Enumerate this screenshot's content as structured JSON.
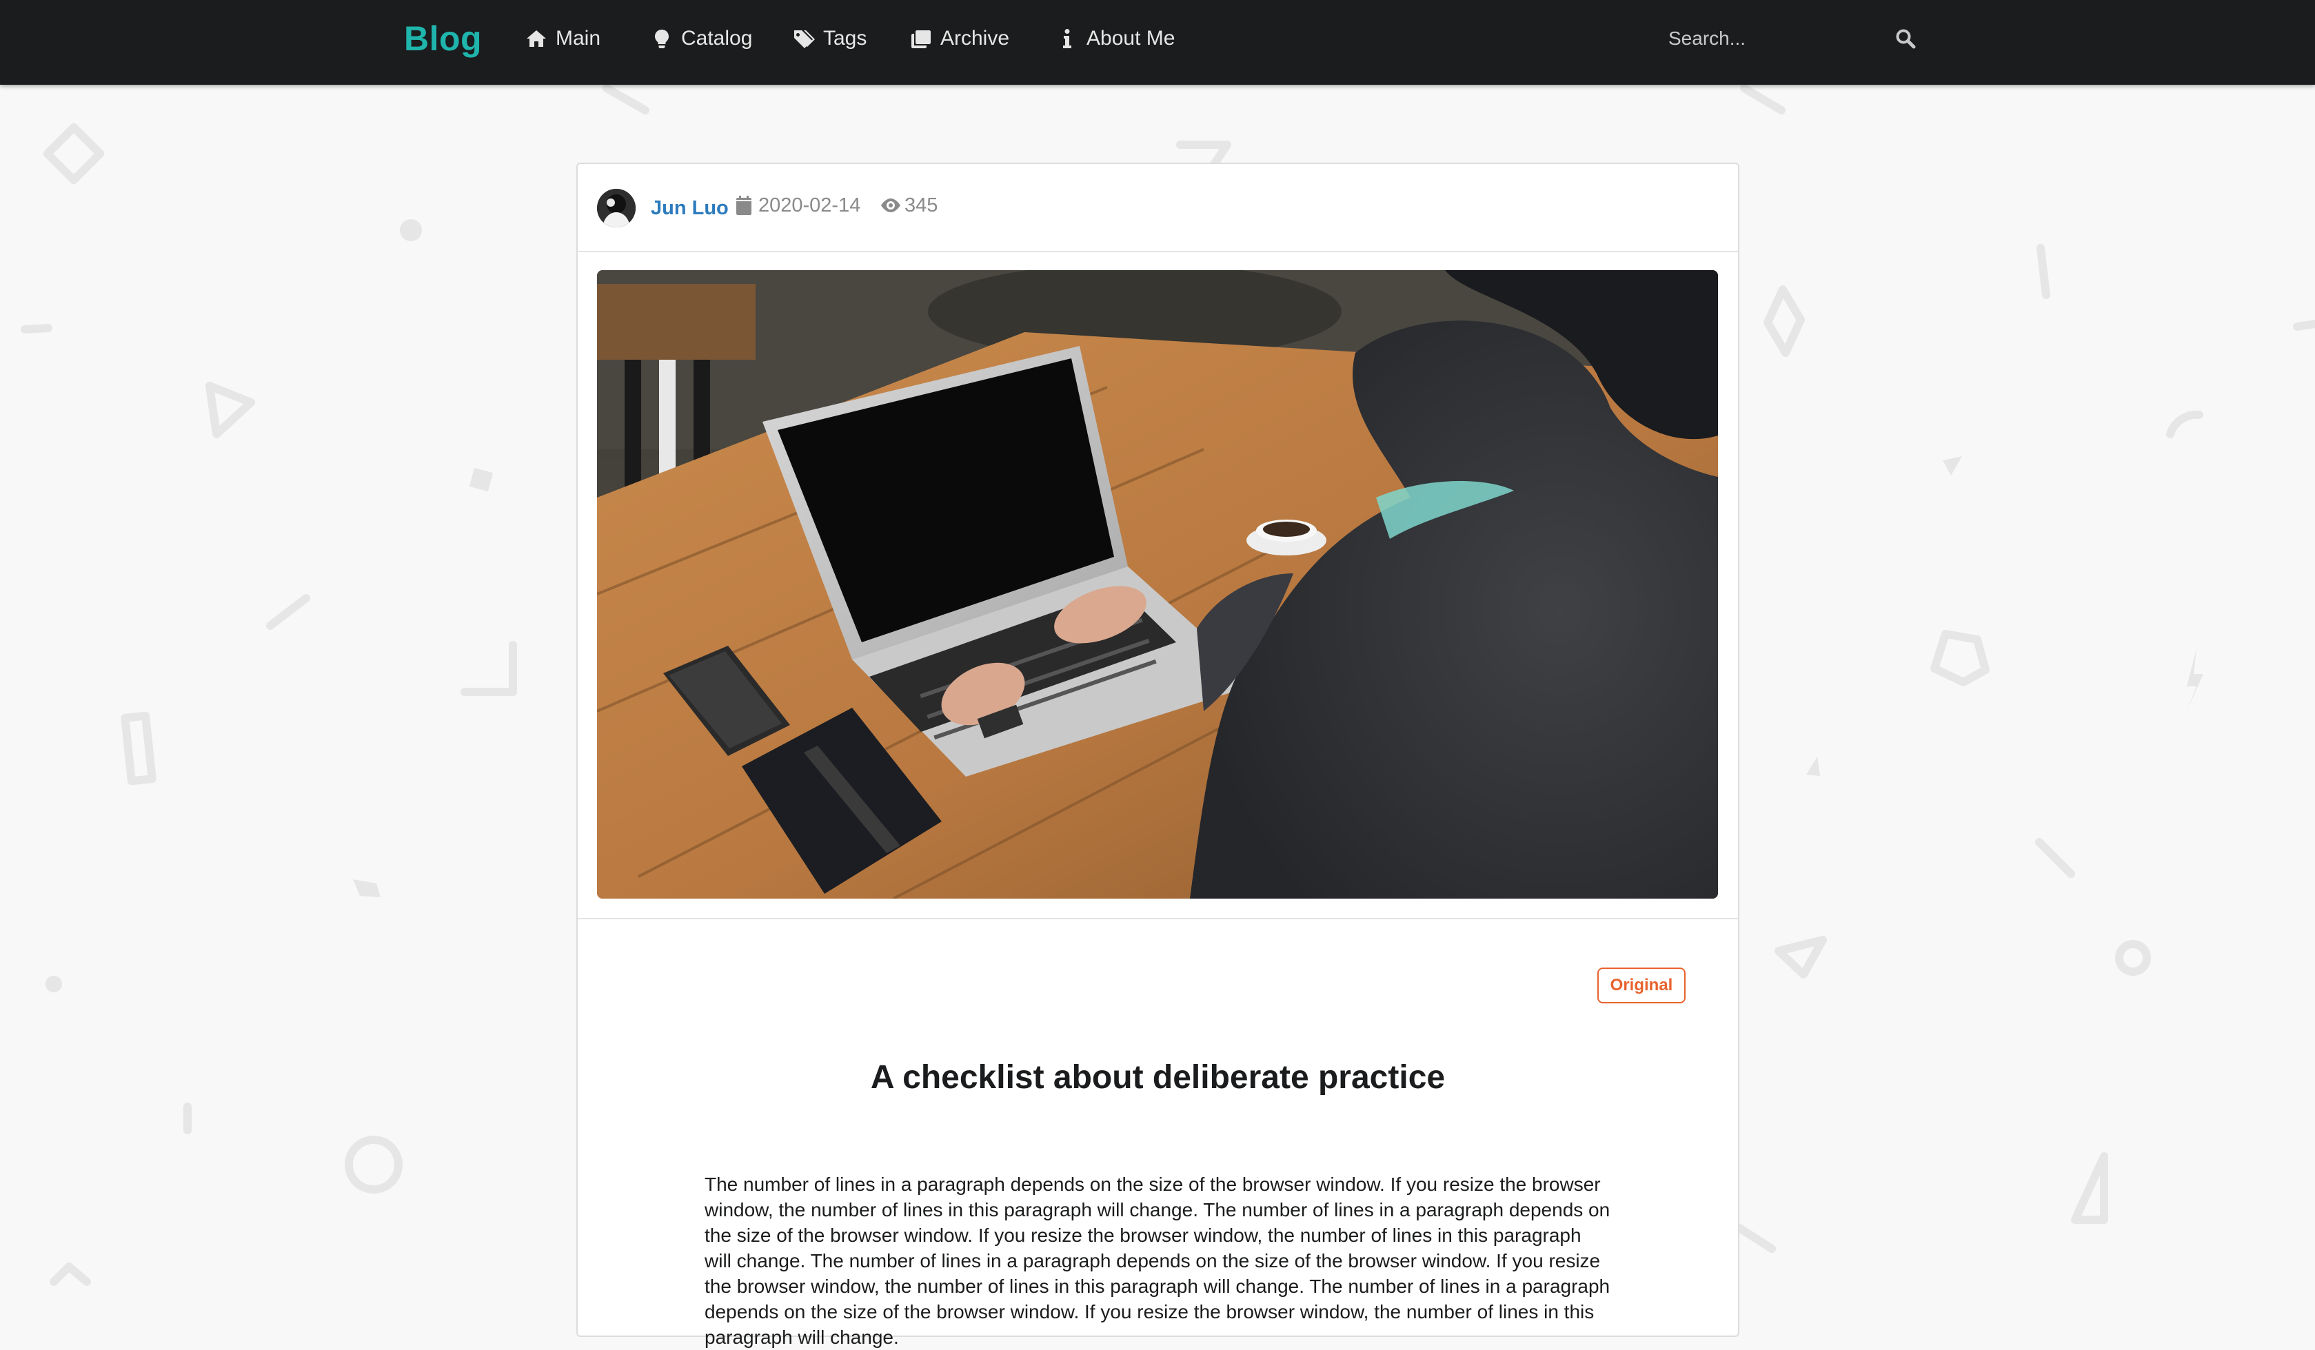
{
  "nav": {
    "brand": "Blog",
    "items": [
      {
        "label": "Main",
        "icon": "home-icon"
      },
      {
        "label": "Catalog",
        "icon": "lightbulb-icon"
      },
      {
        "label": "Tags",
        "icon": "tags-icon"
      },
      {
        "label": "Archive",
        "icon": "clone-icon"
      },
      {
        "label": "About Me",
        "icon": "info-icon"
      }
    ],
    "search_placeholder": "Search...",
    "search_icon": "search-icon"
  },
  "post": {
    "author": "Jun Luo",
    "date": "2020-02-14",
    "views": "345",
    "badge": "Original",
    "title": "A checklist about deliberate practice",
    "body": "The number of lines in a paragraph depends on the size of the browser window. If you resize the browser window, the number of lines in this paragraph will change. The number of lines in a paragraph depends on the size of the browser window. If you resize the browser window, the number of lines in this paragraph will change. The number of lines in a paragraph depends on the size of the browser window. If you resize the browser window, the number of lines in this paragraph will change. The number of lines in a paragraph depends on the size of the browser window. If you resize the browser window, the number of lines in this paragraph will change."
  },
  "colors": {
    "brand": "#1fb5ac",
    "navbar_bg": "#1b1c1d",
    "author_link": "#2c7bbd",
    "badge": "#e8632d",
    "page_bg": "#f8f8f8"
  }
}
